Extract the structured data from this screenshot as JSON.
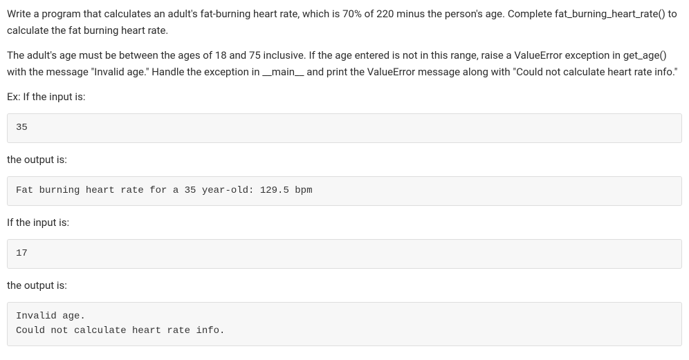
{
  "paragraphs": {
    "p1": "Write a program that calculates an adult's fat-burning heart rate, which is 70% of 220 minus the person's age. Complete fat_burning_heart_rate() to calculate the fat burning heart rate.",
    "p2": "The adult's age must be between the ages of 18 and 75 inclusive. If the age entered is not in this range, raise a ValueError exception in get_age() with the message \"Invalid age.\" Handle the exception in __main__ and print the ValueError message along with \"Could not calculate heart rate info.\"",
    "p3": "Ex: If the input is:",
    "p4": "the output is:",
    "p5": "If the input is:",
    "p6": "the output is:"
  },
  "codeblocks": {
    "c1": "35",
    "c2": "Fat burning heart rate for a 35 year-old: 129.5 bpm",
    "c3": "17",
    "c4": "Invalid age.\nCould not calculate heart rate info."
  }
}
